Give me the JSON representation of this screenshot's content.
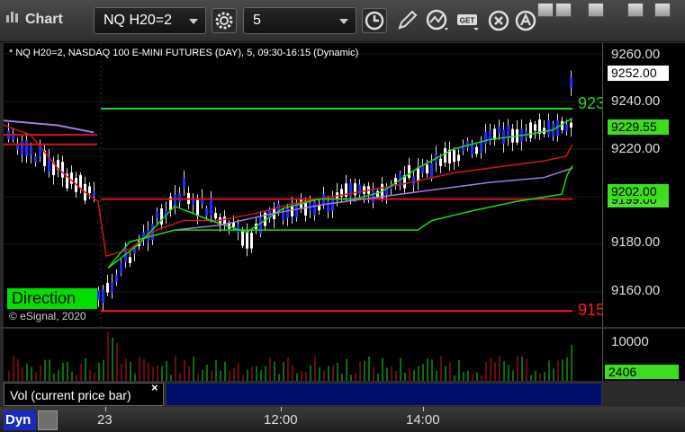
{
  "window": {
    "title": "Chart",
    "symbol_value": "NQ H20=2",
    "interval_value": "5"
  },
  "chart": {
    "description_line": "* NQ H20=2, NASDAQ 100 E-MINI FUTURES (DAY), 5, 09:30-16:15 (Dynamic)",
    "y_labels": [
      "9260.00",
      "9240.00",
      "9220.00",
      "9180.00",
      "9160.00"
    ],
    "last_price": "9252.00",
    "green_tag": "9229.55",
    "green_tag2": "9202.00",
    "gray_tag": "9199.00",
    "resistance_label": "923",
    "support_label": "915",
    "direction_label": "Direction",
    "copyright": "© eSignal, 2020",
    "colors": {
      "up": "#ffffff",
      "down": "#1e2cff",
      "resistance": "#1ed81e",
      "support": "#ff1a1a",
      "direction": "#00e000"
    }
  },
  "volume": {
    "legend": "Vol (current price bar)",
    "close": "×",
    "y_label": "10000",
    "current": "2406",
    "partial": "0"
  },
  "time_axis": {
    "mode": "Dyn",
    "labels": [
      "23",
      "12:00",
      "14:00"
    ]
  }
}
